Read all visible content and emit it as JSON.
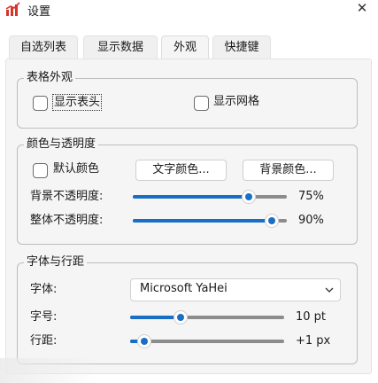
{
  "window": {
    "title": "设置",
    "close_glyph": "✕",
    "icon": "chart-icon",
    "accent": "#1a6fc4",
    "icon_color": "#d9342b"
  },
  "tabs": [
    {
      "label": "自选列表",
      "active": false
    },
    {
      "label": "显示数据",
      "active": false
    },
    {
      "label": "外观",
      "active": true
    },
    {
      "label": "快捷键",
      "active": false
    }
  ],
  "table_appearance": {
    "legend": "表格外观",
    "show_header": {
      "label": "显示表头",
      "checked": false
    },
    "show_grid": {
      "label": "显示网格",
      "checked": false
    }
  },
  "color_opacity": {
    "legend": "颜色与透明度",
    "default_color": {
      "label": "默认颜色",
      "checked": false
    },
    "text_color_button": "文字颜色...",
    "bg_color_button": "背景颜色...",
    "bg_opacity": {
      "label": "背景不透明度:",
      "value_text": "75%",
      "value": 0.75
    },
    "overall_opacity": {
      "label": "整体不透明度:",
      "value_text": "90%",
      "value": 0.9
    }
  },
  "font_spacing": {
    "legend": "字体与行距",
    "font": {
      "label": "字体:",
      "value": "Microsoft YaHei"
    },
    "size": {
      "label": "字号:",
      "value_text": "10 pt",
      "value": 0.33
    },
    "spacing": {
      "label": "行距:",
      "value_text": "+1 px",
      "value": 0.09
    }
  }
}
